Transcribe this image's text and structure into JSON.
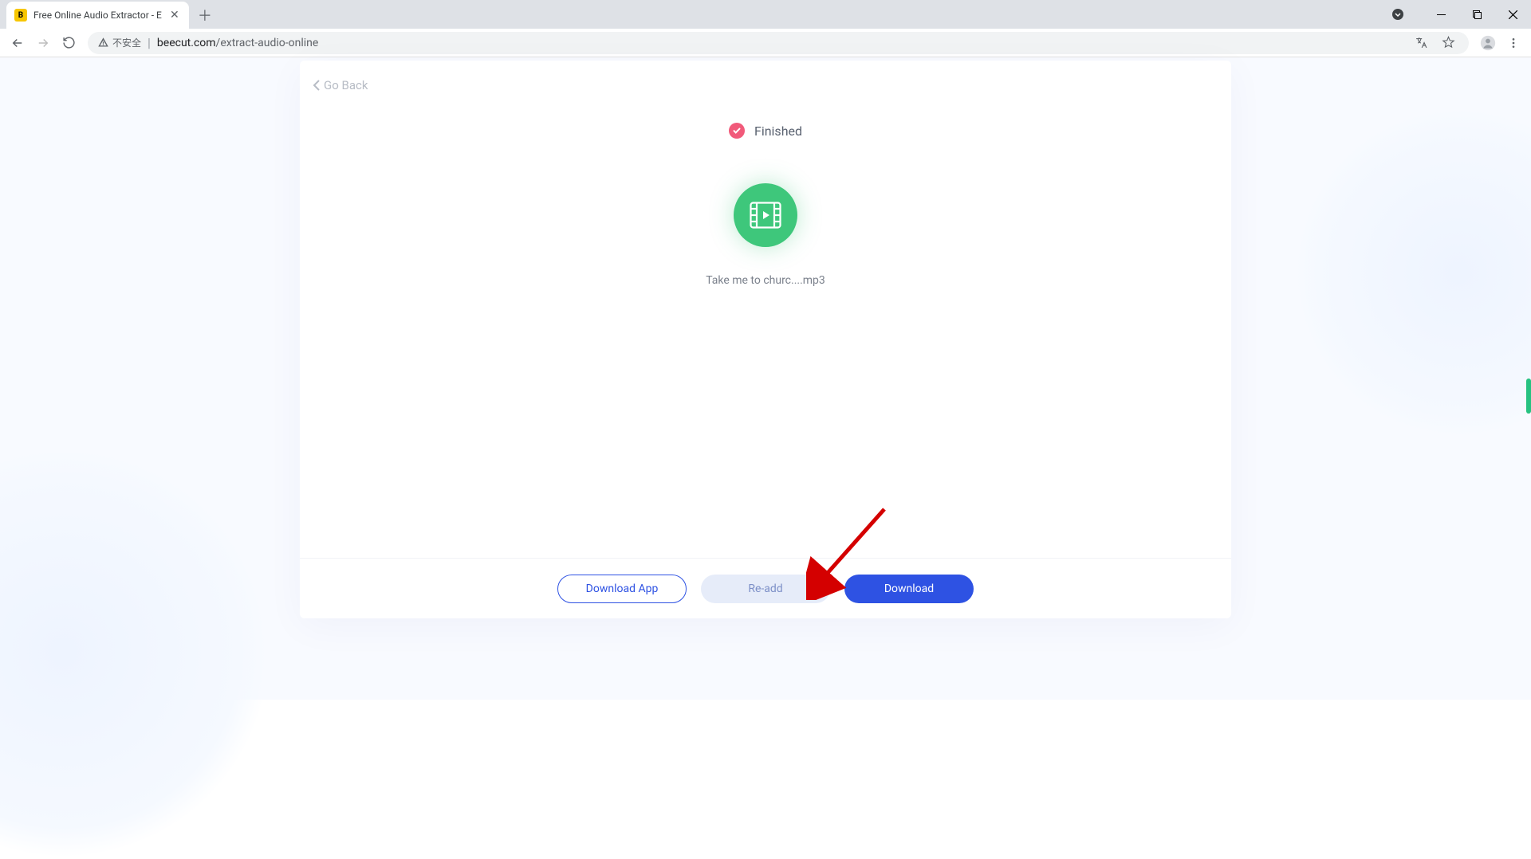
{
  "browser": {
    "tab_title": "Free Online Audio Extractor - E",
    "security_label": "不安全",
    "url_domain": "beecut.com",
    "url_path": "/extract-audio-online"
  },
  "card": {
    "back_label": "Go Back",
    "status_label": "Finished",
    "file_name": "Take me to churc....mp3",
    "buttons": {
      "download_app": "Download App",
      "readd": "Re-add",
      "download": "Download"
    }
  }
}
